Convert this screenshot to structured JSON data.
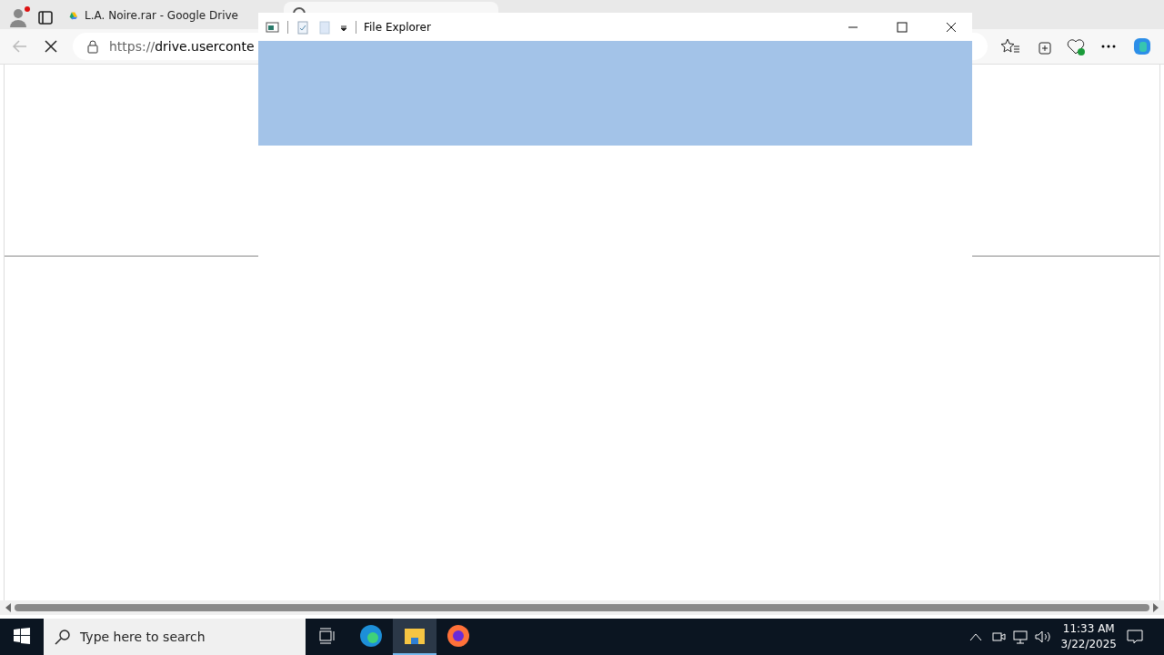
{
  "browser": {
    "tabs": [
      {
        "title": "L.A. Noire.rar - Google Drive",
        "selected": false
      },
      {
        "selected": true
      }
    ],
    "address": {
      "prefix": "https://",
      "host": "drive.userconte"
    },
    "loading": true
  },
  "explorer": {
    "title": "File Explorer"
  },
  "taskbar": {
    "search_placeholder": "Type here to search",
    "apps": [
      {
        "kind": "edge",
        "selected": false
      },
      {
        "kind": "explorer",
        "selected": true
      },
      {
        "kind": "firefox",
        "selected": false
      }
    ],
    "time": "11:33 AM",
    "date": "3/22/2025"
  }
}
